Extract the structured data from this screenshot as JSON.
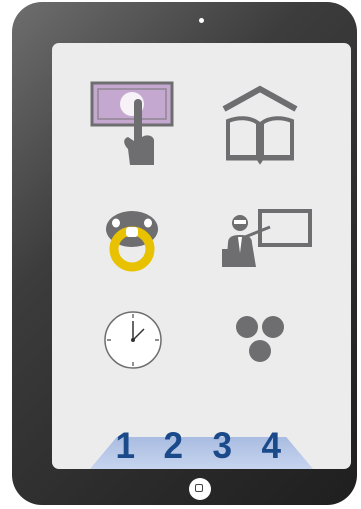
{
  "device": {
    "type": "tablet"
  },
  "app_icons": [
    {
      "name": "money-hand-icon"
    },
    {
      "name": "book-house-icon"
    },
    {
      "name": "baby-pacifier-icon"
    },
    {
      "name": "teacher-board-icon"
    },
    {
      "name": "clock-icon"
    },
    {
      "name": "dots-icon"
    }
  ],
  "pagination": {
    "pages": [
      "1",
      "2",
      "3",
      "4"
    ]
  },
  "colors": {
    "icon_gray": "#6e6e70",
    "pacifier_yellow": "#e8c200",
    "page_number_blue": "#1b4a8a",
    "money_lilac": "#c4a8cf"
  }
}
